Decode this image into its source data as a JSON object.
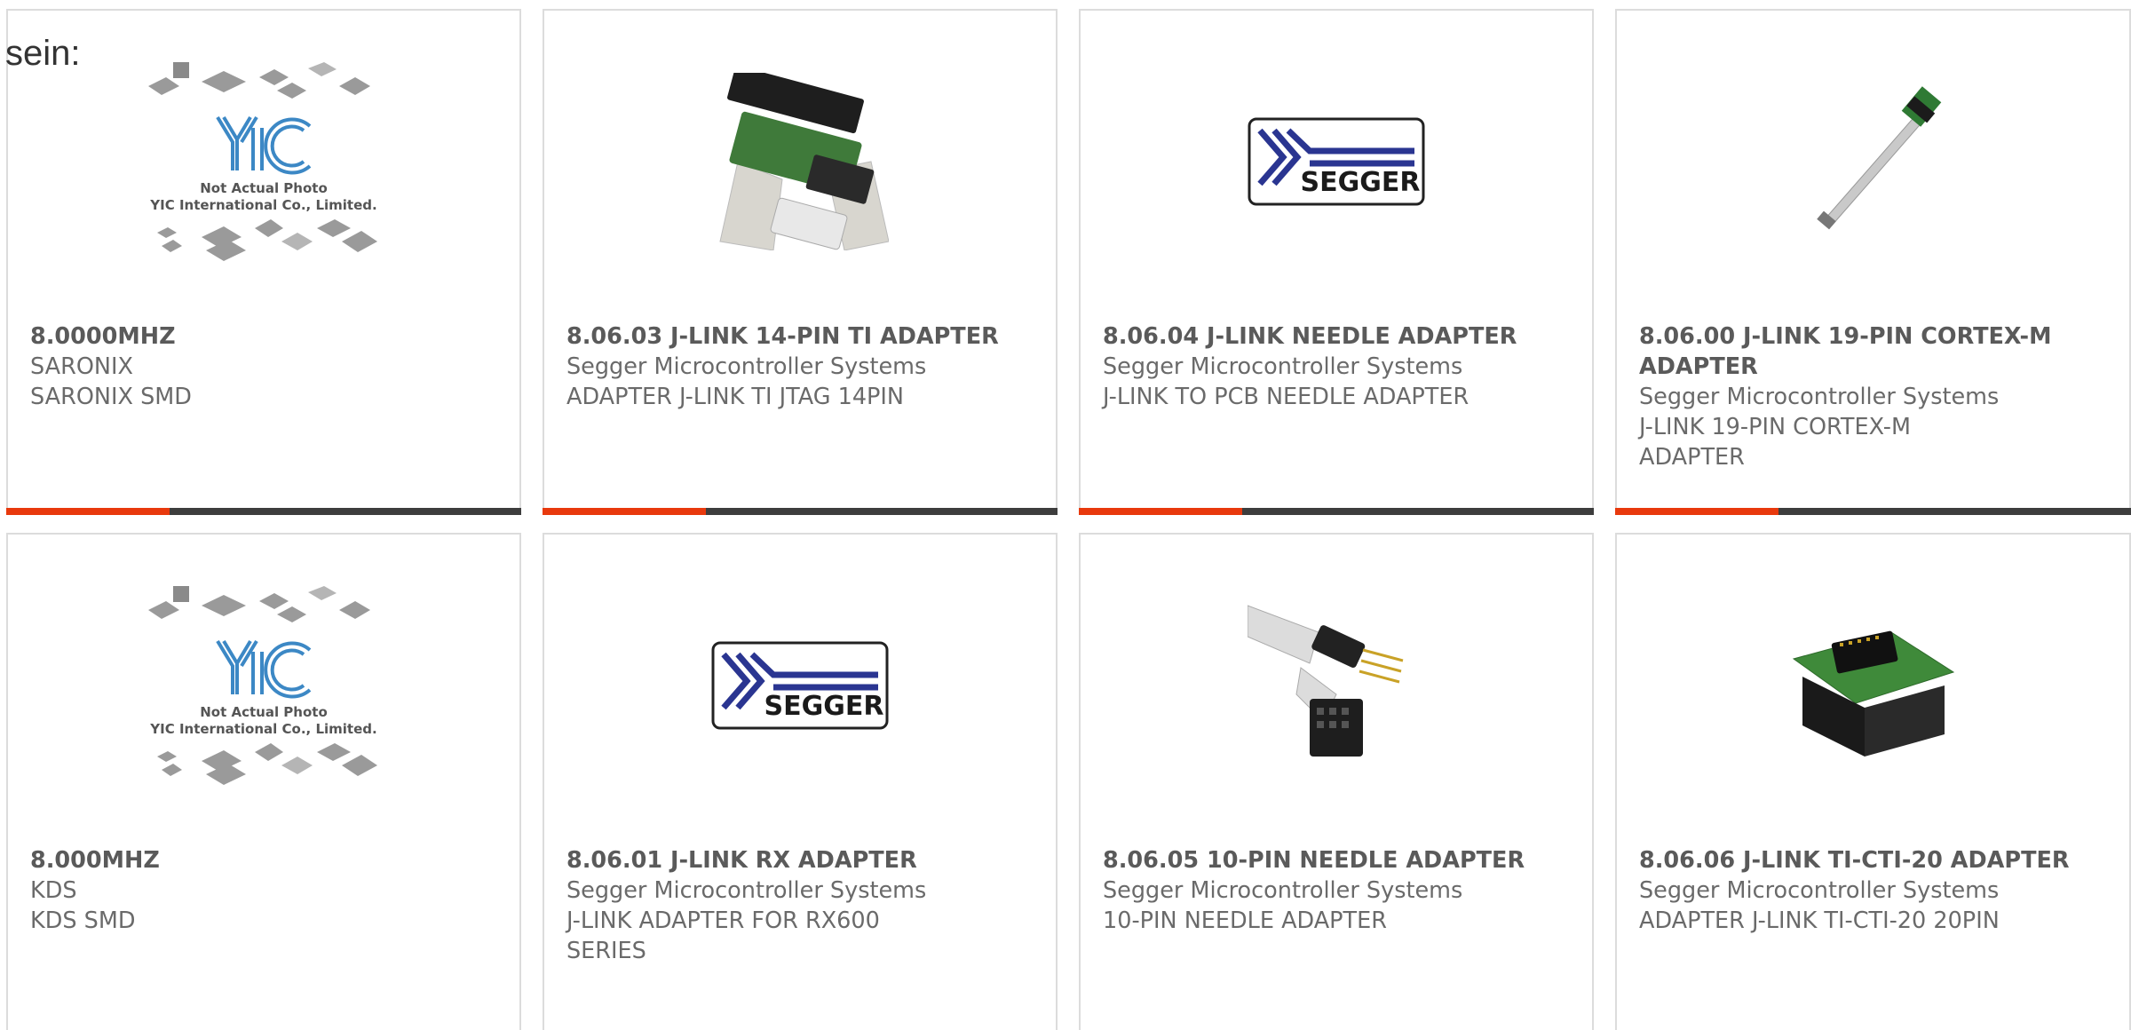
{
  "lead_text": "sein:",
  "colors": {
    "accent": "#e8390d",
    "bar": "#3d3d3d",
    "border": "#dcdcdc",
    "segger_blue": "#2a3591"
  },
  "cards": [
    {
      "image": "yic-placeholder",
      "photo_line1": "Not Actual Photo",
      "photo_line2": "YIC International Co., Limited.",
      "logo_text": "YIC",
      "part": "8.0000MHZ",
      "maker": "SARONIX",
      "desc": "SARONIX SMD"
    },
    {
      "image": "jlink-14pin-cable",
      "part": "8.06.03 J-LINK 14-PIN TI ADAPTER",
      "maker": "Segger Microcontroller Systems",
      "desc": "ADAPTER J-LINK TI JTAG 14PIN"
    },
    {
      "image": "segger-logo",
      "logo_text": "SEGGER",
      "part": "8.06.04 J-LINK NEEDLE ADAPTER",
      "maker": "Segger Microcontroller Systems",
      "desc": "J-LINK TO PCB NEEDLE ADAPTER"
    },
    {
      "image": "cortex-ribbon-cable",
      "part": "8.06.00 J-LINK 19-PIN CORTEX-M ADAPTER",
      "maker": "Segger Microcontroller Systems",
      "desc": "J-LINK 19-PIN CORTEX-M ADAPTER"
    },
    {
      "image": "yic-placeholder",
      "photo_line1": "Not Actual Photo",
      "photo_line2": "YIC International Co., Limited.",
      "logo_text": "YIC",
      "part": "8.000MHZ",
      "maker": "KDS",
      "desc": "KDS SMD"
    },
    {
      "image": "segger-logo",
      "logo_text": "SEGGER",
      "part": "8.06.01 J-LINK RX ADAPTER",
      "maker": "Segger Microcontroller Systems",
      "desc": "J-LINK ADAPTER FOR RX600 SERIES"
    },
    {
      "image": "needle-cable",
      "part": "8.06.05 10-PIN NEEDLE ADAPTER",
      "maker": "Segger Microcontroller Systems",
      "desc": "10-PIN NEEDLE ADAPTER"
    },
    {
      "image": "ti-cti-board",
      "part": "8.06.06 J-LINK TI-CTI-20 ADAPTER",
      "maker": "Segger Microcontroller Systems",
      "desc": "ADAPTER J-LINK TI-CTI-20 20PIN"
    }
  ]
}
